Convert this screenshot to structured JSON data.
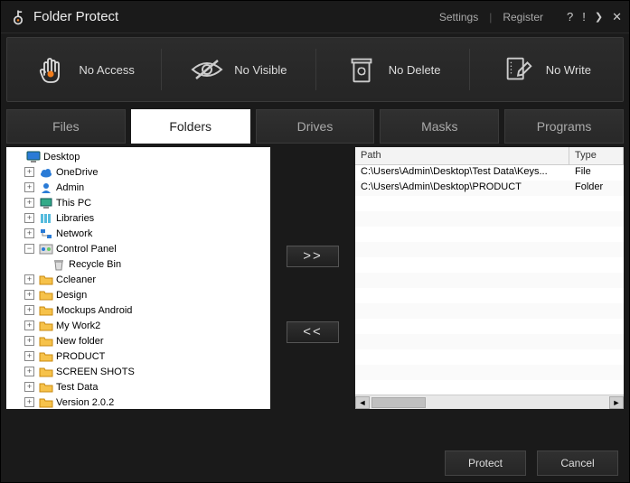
{
  "app": {
    "title": "Folder Protect"
  },
  "titlebar": {
    "settings": "Settings",
    "register": "Register"
  },
  "options": [
    {
      "id": "no-access",
      "label": "No Access",
      "icon": "hand-icon"
    },
    {
      "id": "no-visible",
      "label": "No Visible",
      "icon": "eye-icon"
    },
    {
      "id": "no-delete",
      "label": "No Delete",
      "icon": "trash-icon"
    },
    {
      "id": "no-write",
      "label": "No Write",
      "icon": "write-icon"
    }
  ],
  "tabs": [
    {
      "id": "files",
      "label": "Files",
      "active": false
    },
    {
      "id": "folders",
      "label": "Folders",
      "active": true
    },
    {
      "id": "drives",
      "label": "Drives",
      "active": false
    },
    {
      "id": "masks",
      "label": "Masks",
      "active": false
    },
    {
      "id": "programs",
      "label": "Programs",
      "active": false
    }
  ],
  "tree": [
    {
      "label": "Desktop",
      "level": 1,
      "expand": "none",
      "icon": "monitor"
    },
    {
      "label": "OneDrive",
      "level": 2,
      "expand": "plus",
      "icon": "cloud"
    },
    {
      "label": "Admin",
      "level": 2,
      "expand": "plus",
      "icon": "user"
    },
    {
      "label": "This PC",
      "level": 2,
      "expand": "plus",
      "icon": "pc"
    },
    {
      "label": "Libraries",
      "level": 2,
      "expand": "plus",
      "icon": "lib"
    },
    {
      "label": "Network",
      "level": 2,
      "expand": "plus",
      "icon": "net"
    },
    {
      "label": "Control Panel",
      "level": 2,
      "expand": "minus",
      "icon": "cp"
    },
    {
      "label": "Recycle Bin",
      "level": 3,
      "expand": "none",
      "icon": "bin"
    },
    {
      "label": "Ccleaner",
      "level": 2,
      "expand": "plus",
      "icon": "folder"
    },
    {
      "label": "Design",
      "level": 2,
      "expand": "plus",
      "icon": "folder"
    },
    {
      "label": "Mockups Android",
      "level": 2,
      "expand": "plus",
      "icon": "folder"
    },
    {
      "label": "My Work2",
      "level": 2,
      "expand": "plus",
      "icon": "folder"
    },
    {
      "label": "New folder",
      "level": 2,
      "expand": "plus",
      "icon": "folder"
    },
    {
      "label": "PRODUCT",
      "level": 2,
      "expand": "plus",
      "icon": "folder"
    },
    {
      "label": "SCREEN SHOTS",
      "level": 2,
      "expand": "plus",
      "icon": "folder"
    },
    {
      "label": "Test Data",
      "level": 2,
      "expand": "plus",
      "icon": "folder"
    },
    {
      "label": "Version 2.0.2",
      "level": 2,
      "expand": "plus",
      "icon": "folder"
    }
  ],
  "transfer": {
    "add_label": ">>",
    "remove_label": "<<"
  },
  "grid": {
    "headers": {
      "path": "Path",
      "type": "Type"
    },
    "rows": [
      {
        "path": "C:\\Users\\Admin\\Desktop\\Test Data\\Keys...",
        "type": "File"
      },
      {
        "path": "C:\\Users\\Admin\\Desktop\\PRODUCT",
        "type": "Folder"
      }
    ]
  },
  "footer": {
    "protect": "Protect",
    "cancel": "Cancel"
  },
  "colors": {
    "accent": "#f07c1c"
  }
}
